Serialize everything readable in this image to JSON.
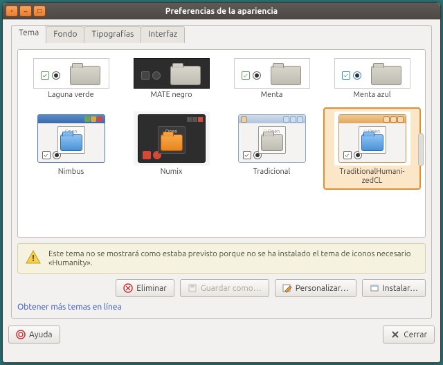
{
  "window": {
    "title": "Preferencias de la apariencia"
  },
  "tabs": [
    {
      "label": "Tema",
      "active": true
    },
    {
      "label": "Fondo",
      "active": false
    },
    {
      "label": "Tipografías",
      "active": false
    },
    {
      "label": "Interfaz",
      "active": false
    }
  ],
  "themes_row1": [
    {
      "name": "Laguna verde"
    },
    {
      "name": "MATE negro"
    },
    {
      "name": "Menta"
    },
    {
      "name": "Menta azul"
    }
  ],
  "themes_row2": [
    {
      "name": "Nimbus"
    },
    {
      "name": "Numix"
    },
    {
      "name": "Tradicional"
    },
    {
      "name": "TraditionalHumani-\nzedCL",
      "selected": true
    }
  ],
  "warning": {
    "text": "Este tema no se mostrará como estaba previsto porque no se ha instalado el tema de iconos necesario «Humanity»."
  },
  "buttons": {
    "delete": "Eliminar",
    "save_as": "Guardar como…",
    "customize": "Personalizar…",
    "install": "Instalar…"
  },
  "link_text": "Obtener más temas en línea",
  "footer": {
    "help": "Ayuda",
    "close": "Cerrar"
  }
}
